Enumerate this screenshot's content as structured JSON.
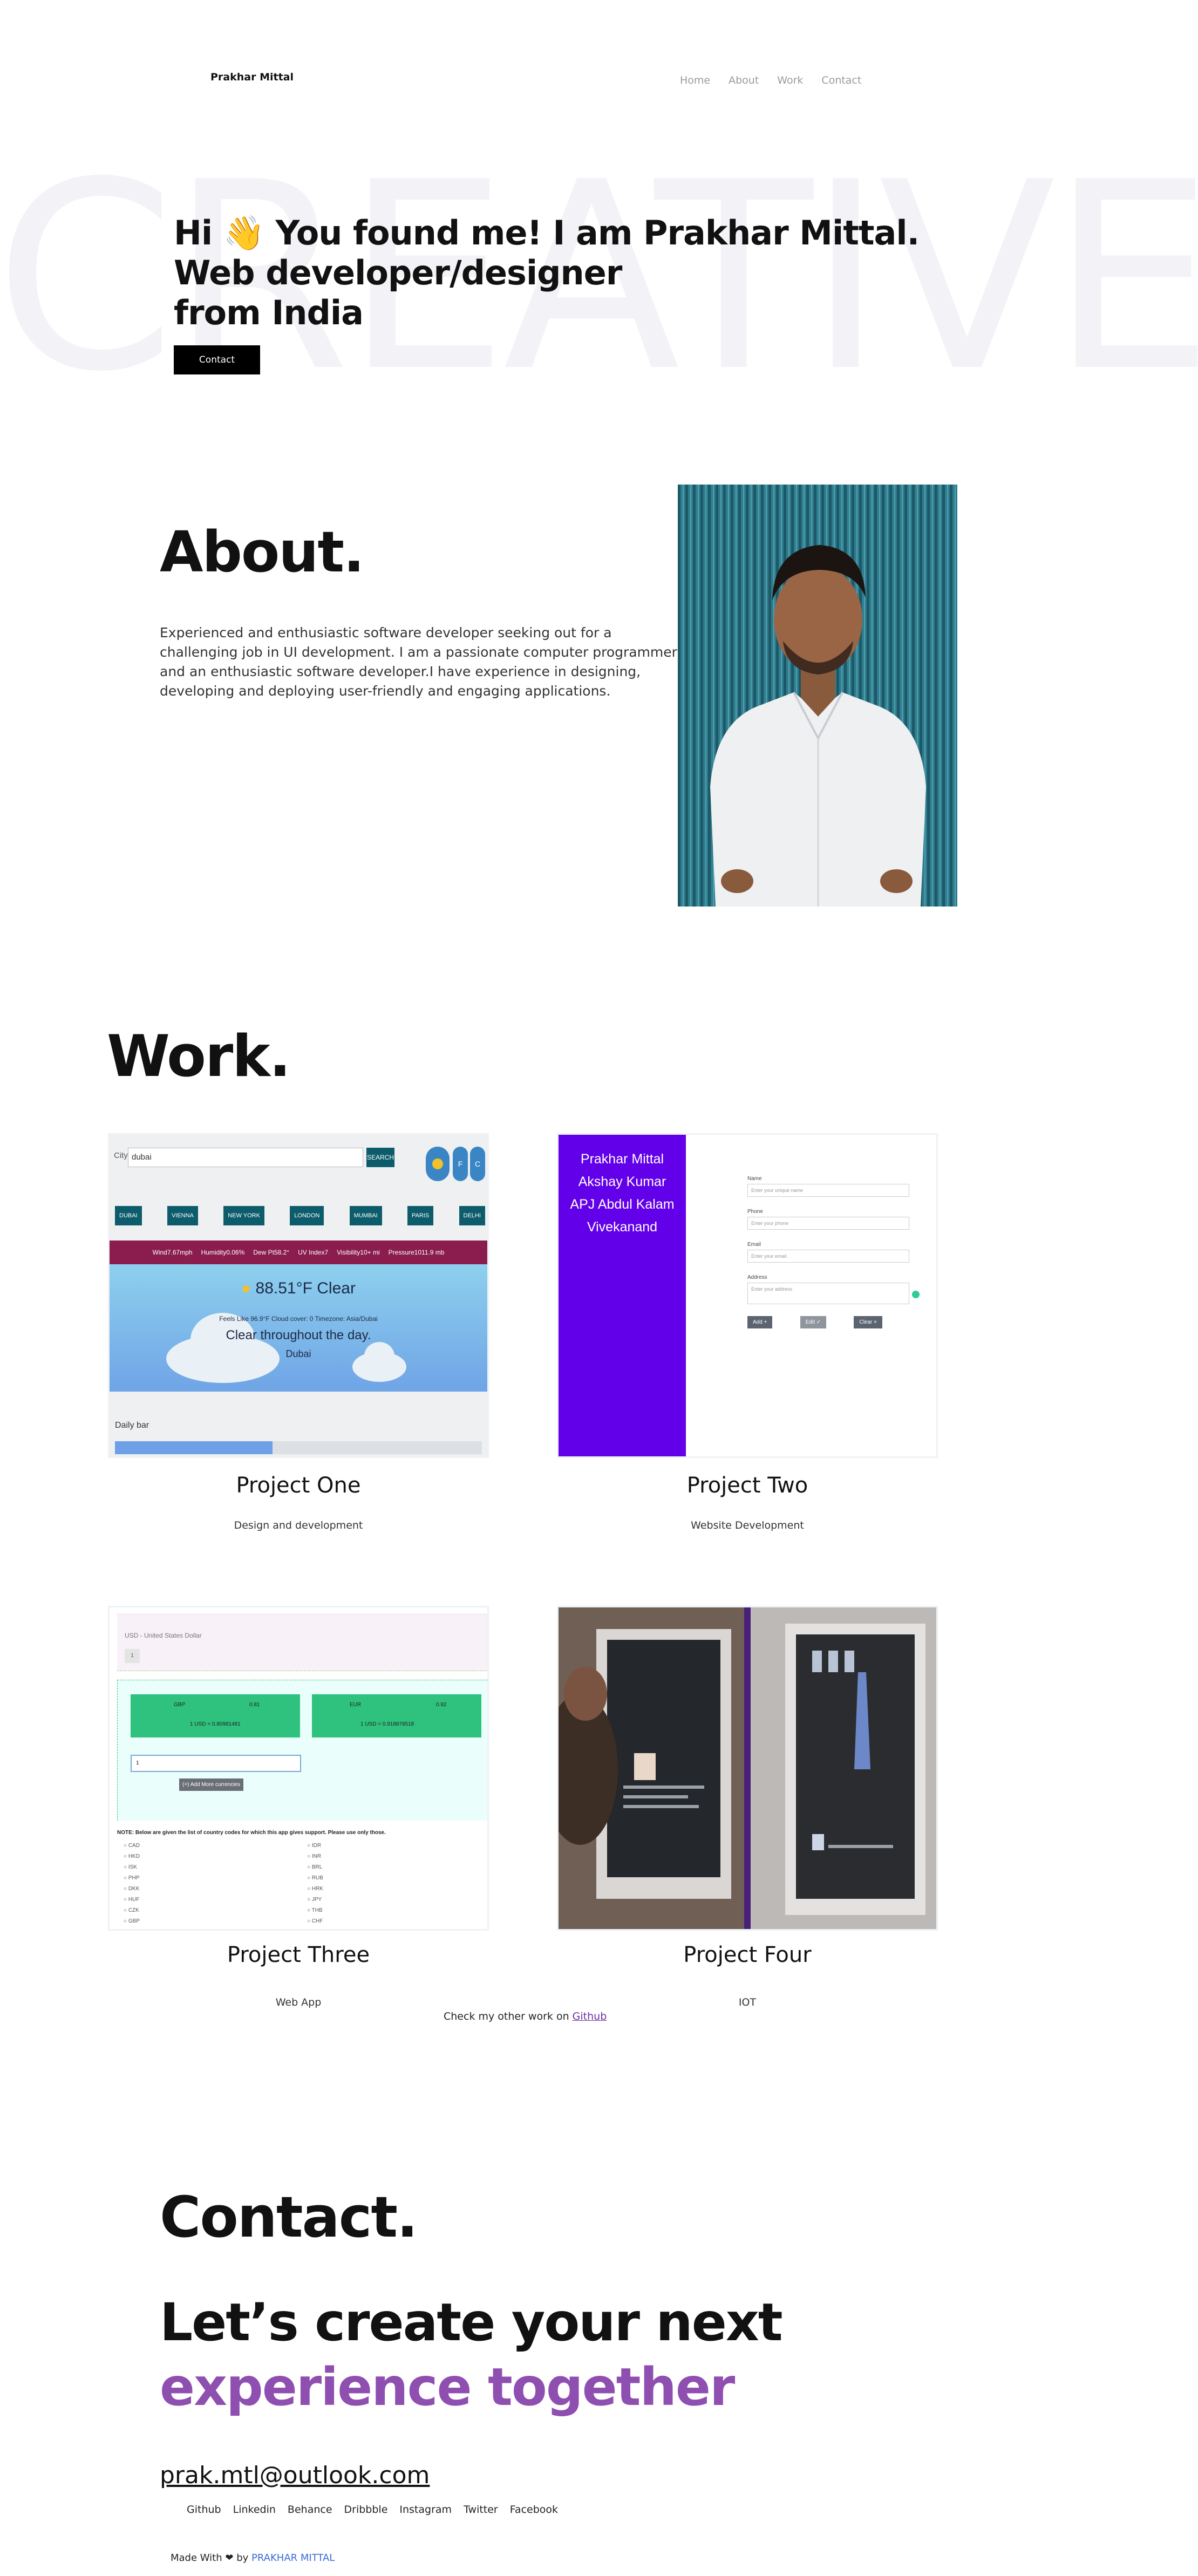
{
  "header": {
    "logo": "Prakhar Mittal",
    "nav": [
      "Home",
      "About",
      "Work",
      "Contact"
    ]
  },
  "hero": {
    "background_word": "CREATIVE",
    "title_lines": [
      "Hi 👋 You found me! I am Prakhar Mittal.",
      "Web developer/designer",
      "from India"
    ],
    "contact_button": "Contact"
  },
  "about": {
    "heading": "About.",
    "text": "Experienced and enthusiastic software developer seeking out for a challenging job in UI development. I am a passionate computer programmer and an enthusiastic software developer.I have experience in designing, developing and deploying user-friendly and engaging applications."
  },
  "work": {
    "heading": "Work.",
    "projects": [
      {
        "title": "Project One",
        "subtitle": "Design and development",
        "weather": {
          "city_label": "City",
          "city_value": "dubai",
          "search": "SEARCH",
          "cities": [
            "DUBAI",
            "VIENNA",
            "NEW YORK",
            "LONDON",
            "MUMBAI",
            "PARIS",
            "DELHI"
          ],
          "stats": [
            "Wind7.67mph",
            "Humidity0.06%",
            "Dew Pt58.2°",
            "UV Index7",
            "Visibility10+ mi",
            "Pressure1011.9 mb"
          ],
          "temp": "88.51°F Clear",
          "feels": "Feels Like 96.9°F   Cloud cover: 0   Timezone: Asia/Dubai",
          "summary": "Clear throughout the day.",
          "place": "Dubai",
          "bar_label": "Daily bar",
          "bar_fraction": 0.43
        }
      },
      {
        "title": "Project Two",
        "subtitle": "Website Development",
        "form": {
          "names": [
            "Prakhar Mittal",
            "Akshay Kumar",
            "APJ Abdul Kalam",
            "Vivekanand"
          ],
          "fields": [
            {
              "label": "Name",
              "placeholder": "Enter your unique name"
            },
            {
              "label": "Phone",
              "placeholder": "Enter your phone"
            },
            {
              "label": "Email",
              "placeholder": "Enter your email"
            },
            {
              "label": "Address",
              "placeholder": "Enter your address"
            }
          ],
          "buttons": [
            "Add +",
            "Edit ✓",
            "Clear ×"
          ]
        }
      },
      {
        "title": "Project Three",
        "subtitle": "Web App",
        "currency": {
          "base": "USD - United States Dollar",
          "base_amount": "1",
          "cards": [
            {
              "code": "GBP",
              "value": "0.81",
              "rate": "1 USD = 0.80981481"
            },
            {
              "code": "EUR",
              "value": "0.92",
              "rate": "1 USD = 0.918878518"
            }
          ],
          "input_value": "1",
          "add_button": "(+) Add More currencies",
          "note": "NOTE: Below are given the list of country codes for which this app gives support. Please use only those.",
          "codes_left": [
            "CAD",
            "HKD",
            "ISK",
            "PHP",
            "DKK",
            "HUF",
            "CZK",
            "GBP"
          ],
          "codes_right": [
            "IDR",
            "INR",
            "BRL",
            "RUB",
            "HRK",
            "JPY",
            "THB",
            "CHF"
          ]
        }
      },
      {
        "title": "Project Four",
        "subtitle": "IOT"
      }
    ],
    "github_prefix": "Check my other work on",
    "github_link": "Github"
  },
  "contact": {
    "heading": "Contact.",
    "cta_line1": "Let’s create your next",
    "cta_line2": "experience together",
    "email": "prak.mtl@outlook.com",
    "social": [
      "Github",
      "Linkedin",
      "Behance",
      "Dribbble",
      "Instagram",
      "Twitter",
      "Facebook"
    ]
  },
  "footer": {
    "made_with": "Made With",
    "heart": "❤",
    "by": "by",
    "author": "PRAKHAR MITTAL"
  },
  "colors": {
    "accent_purple": "#8e4fb0",
    "project_two_sidebar": "#6200ea",
    "weather_teal": "#0d5c6b",
    "weather_band": "#8a1d4e",
    "currency_green": "#2ec27e",
    "link_blue": "#3a6ad8"
  }
}
